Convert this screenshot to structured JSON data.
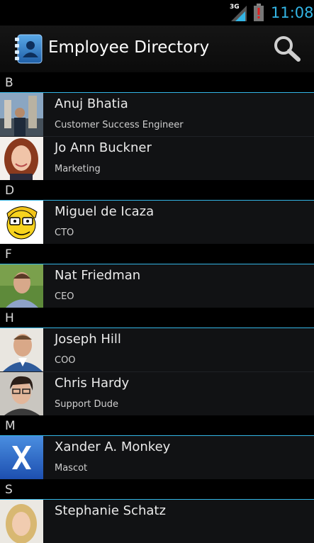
{
  "status_bar": {
    "network_type": "3G",
    "time": "11:08"
  },
  "action_bar": {
    "title": "Employee Directory",
    "app_icon": "contacts-book-icon",
    "search_icon": "search-icon"
  },
  "colors": {
    "accent": "#33b5e5",
    "background": "#000000",
    "row_background": "#111214"
  },
  "sections": [
    {
      "letter": "B",
      "employees": [
        {
          "name": "Anuj Bhatia",
          "title": "Customer Success Engineer",
          "avatar": "photo-anuj"
        },
        {
          "name": "Jo Ann Buckner",
          "title": "Marketing",
          "avatar": "photo-joann"
        }
      ]
    },
    {
      "letter": "D",
      "employees": [
        {
          "name": "Miguel de Icaza",
          "title": "CTO",
          "avatar": "cartoon-miguel"
        }
      ]
    },
    {
      "letter": "F",
      "employees": [
        {
          "name": "Nat Friedman",
          "title": "CEO",
          "avatar": "photo-nat"
        }
      ]
    },
    {
      "letter": "H",
      "employees": [
        {
          "name": "Joseph Hill",
          "title": "COO",
          "avatar": "photo-joseph"
        },
        {
          "name": "Chris Hardy",
          "title": "Support Dude",
          "avatar": "photo-chris"
        }
      ]
    },
    {
      "letter": "M",
      "employees": [
        {
          "name": "Xander A. Monkey",
          "title": "Mascot",
          "avatar": "logo-x"
        }
      ]
    },
    {
      "letter": "S",
      "employees": [
        {
          "name": "Stephanie Schatz",
          "title": "",
          "avatar": "photo-stephanie"
        }
      ]
    }
  ]
}
